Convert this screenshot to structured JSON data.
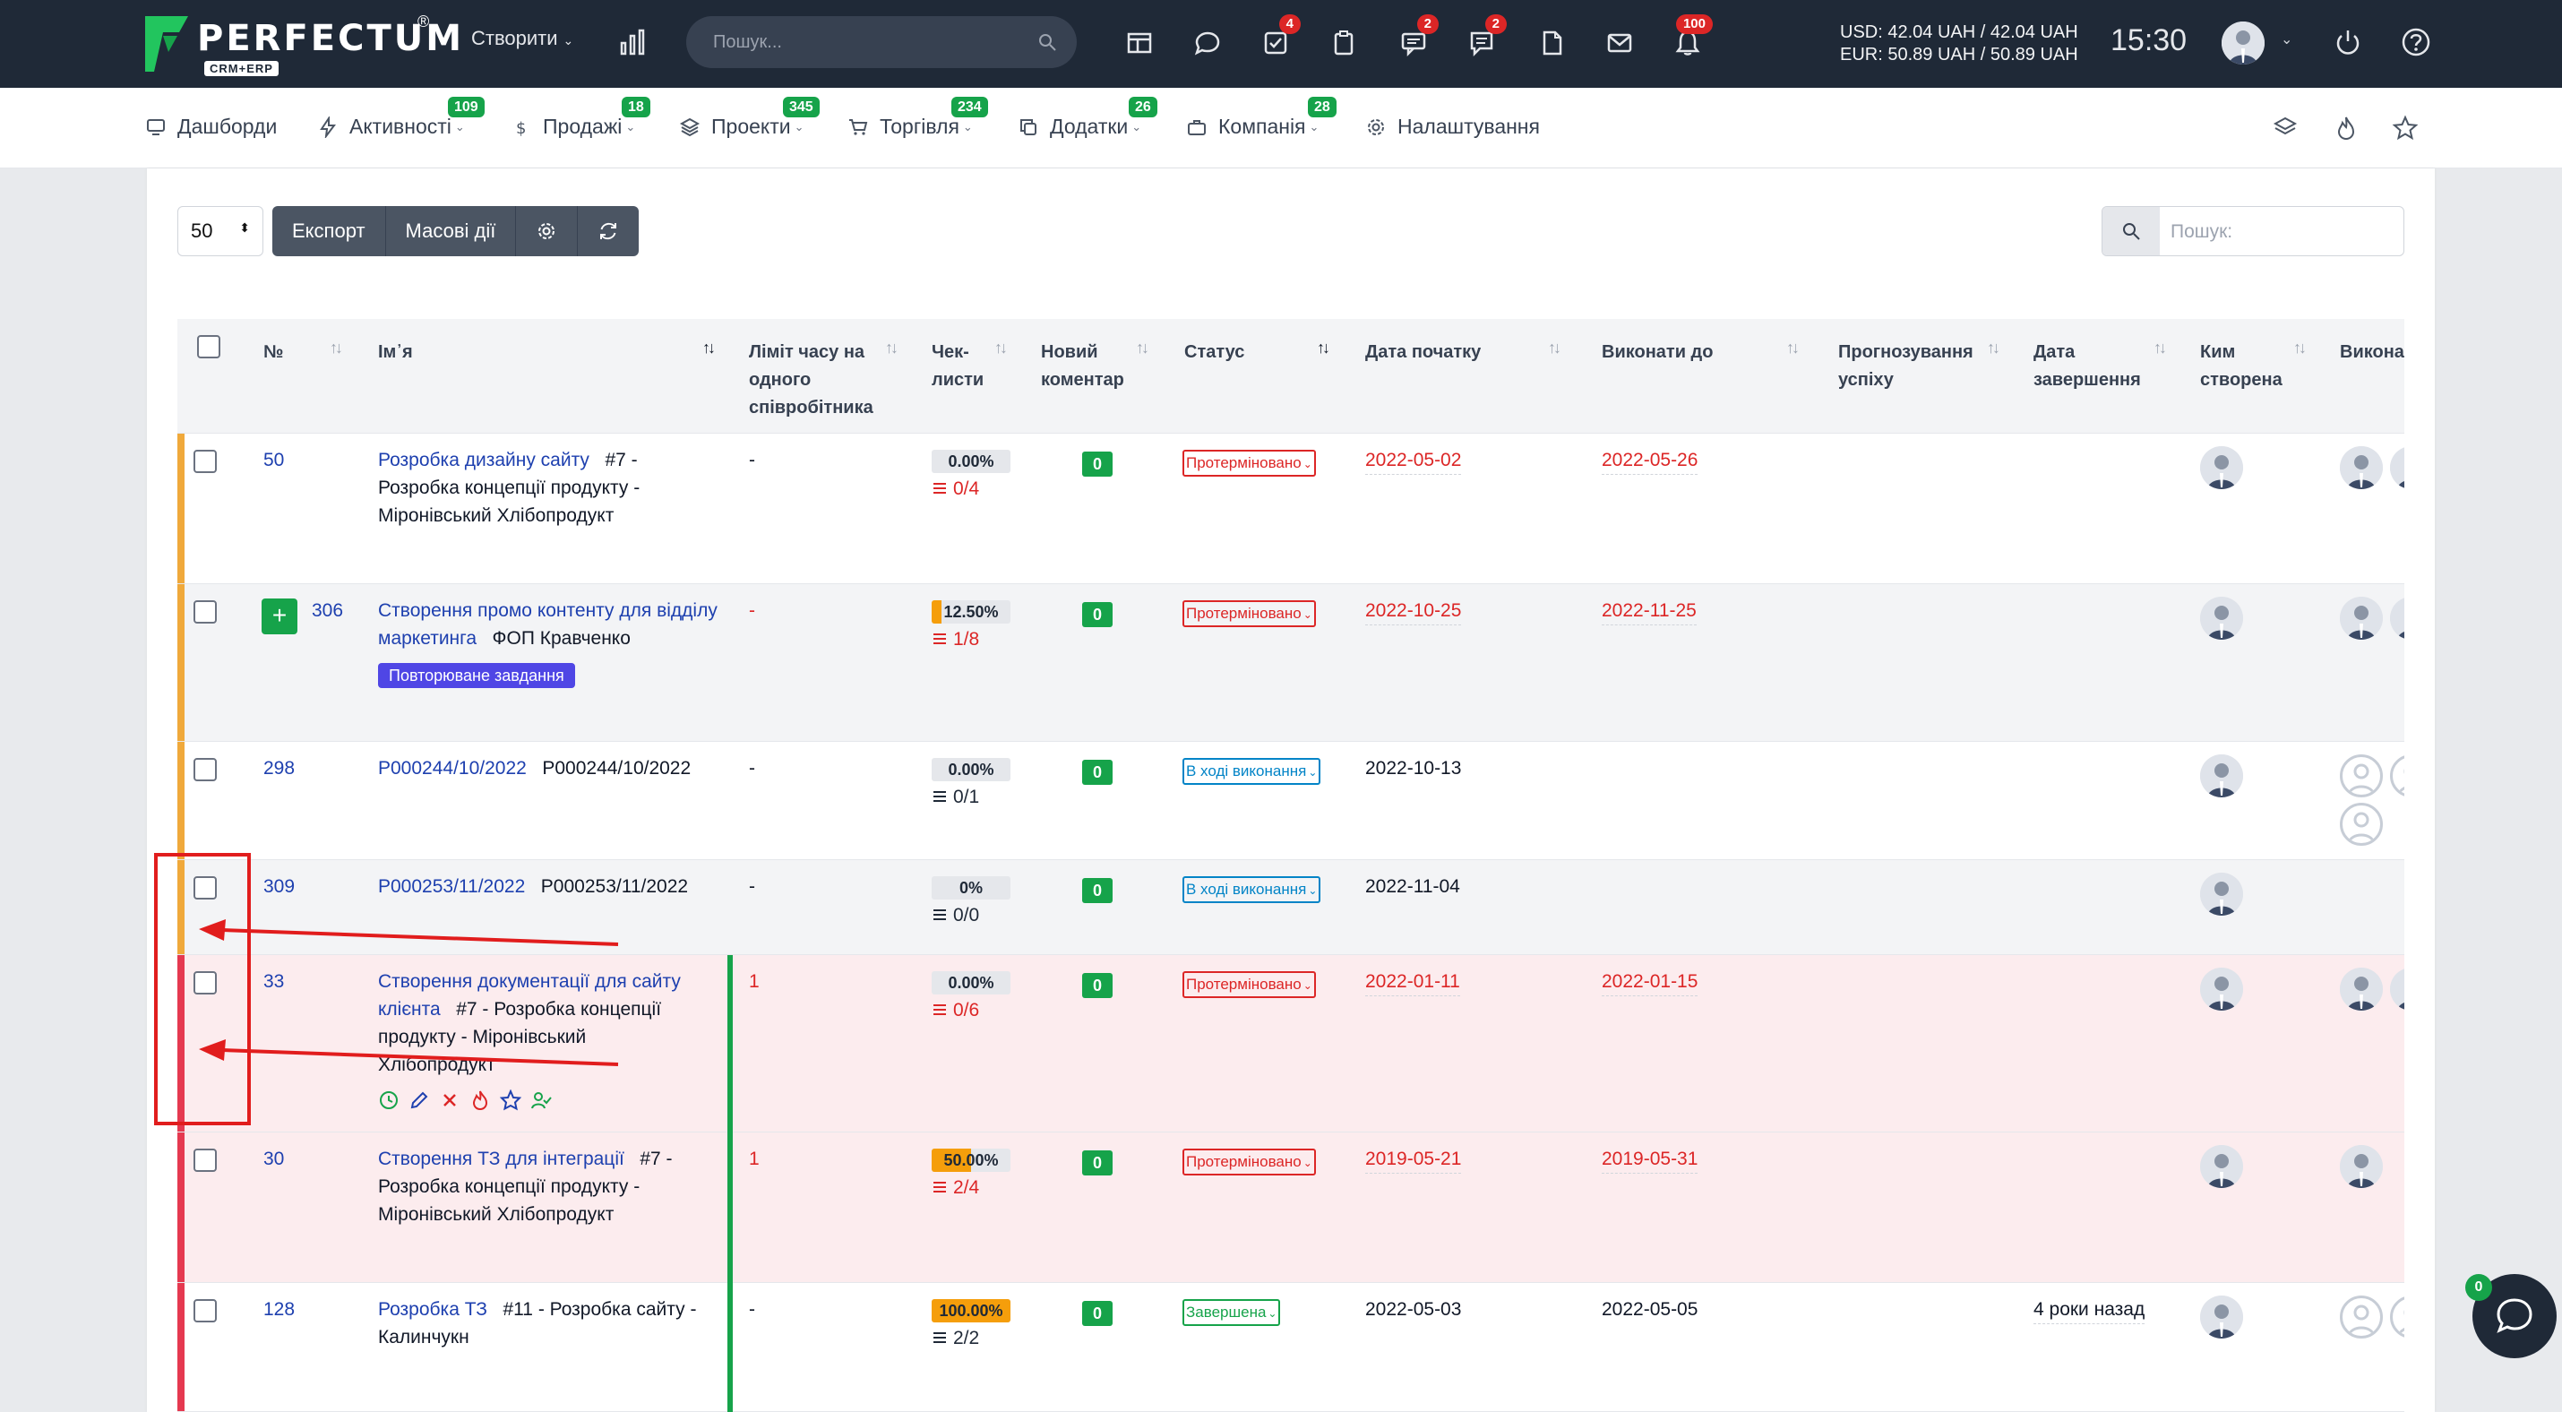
{
  "topbar": {
    "logo_text": "PERFECTUM",
    "logo_sub": "CRM+ERP",
    "logo_reg": "®",
    "create_label": "Створити",
    "search_placeholder": "Пошук...",
    "badges": {
      "tasks": "4",
      "chat": "2",
      "messages": "2",
      "notifications": "100"
    },
    "currency_usd": "USD: 42.04 UAH / 42.04 UAH",
    "currency_eur": "EUR: 50.89 UAH / 50.89 UAH",
    "time": "15:30"
  },
  "nav": {
    "items": [
      {
        "label": "Дашборди",
        "icon": "monitor-icon",
        "badge": ""
      },
      {
        "label": "Активності",
        "icon": "bolt-icon",
        "badge": "109"
      },
      {
        "label": "Продажі",
        "icon": "dollar-icon",
        "badge": "18"
      },
      {
        "label": "Проекти",
        "icon": "layers-icon",
        "badge": "345"
      },
      {
        "label": "Торгівля",
        "icon": "cart-icon",
        "badge": "234"
      },
      {
        "label": "Додатки",
        "icon": "copy-icon",
        "badge": "26"
      },
      {
        "label": "Компанія",
        "icon": "briefcase-icon",
        "badge": "28"
      },
      {
        "label": "Налаштування",
        "icon": "gear-icon",
        "badge": ""
      }
    ]
  },
  "toolbar": {
    "page_size": "50",
    "export_label": "Експорт",
    "bulk_label": "Масові дії",
    "search_placeholder": "Пошук:"
  },
  "table": {
    "columns": {
      "num": "№",
      "name": "Ім᾽я",
      "time_limit": "Ліміт часу на одного співробітника",
      "checklists": "Чек-листи",
      "new_comment": "Новий коментар",
      "status": "Статус",
      "start_date": "Дата початку",
      "due_date": "Виконати до",
      "forecast": "Прогнозування успіху",
      "end_date": "Дата завершення",
      "created_by": "Ким створена",
      "assignees": "Викона"
    },
    "rows": [
      {
        "num": "50",
        "name_link": "Розробка дизайну сайту",
        "name_rest": "#7 - Розробка концепції продукту - Міронівський Хлібопродукт",
        "limit": "-",
        "pct": "0.00%",
        "pct_value": 0,
        "checklist": "0/4",
        "comments": "0",
        "status": "Протерміновано",
        "start": "2022-05-02",
        "due": "2022-05-26",
        "end": ""
      },
      {
        "num": "306",
        "name_link": "Створення промо контенту для відділу маркетинга",
        "name_rest": "ФОП Кравченко",
        "tag": "Повторюване завдання",
        "limit": "-",
        "pct": "12.50%",
        "pct_value": 12.5,
        "checklist": "1/8",
        "comments": "0",
        "status": "Протерміновано",
        "start": "2022-10-25",
        "due": "2022-11-25",
        "end": ""
      },
      {
        "num": "298",
        "name_link": "P000244/10/2022",
        "name_rest": "P000244/10/2022",
        "limit": "-",
        "pct": "0.00%",
        "pct_value": 0,
        "checklist": "0/1",
        "comments": "0",
        "status": "В ході виконання",
        "start": "2022-10-13",
        "due": "",
        "end": ""
      },
      {
        "num": "309",
        "name_link": "P000253/11/2022",
        "name_rest": "P000253/11/2022",
        "limit": "-",
        "pct": "0%",
        "pct_value": 0,
        "checklist": "0/0",
        "comments": "0",
        "status": "В ході виконання",
        "start": "2022-11-04",
        "due": "",
        "end": ""
      },
      {
        "num": "33",
        "name_link": "Створення документації для сайту клієнта",
        "name_rest": "#7 - Розробка концепції продукту - Міронівський Хлібопродукт",
        "limit": "1",
        "pct": "0.00%",
        "pct_value": 0,
        "checklist": "0/6",
        "comments": "0",
        "status": "Протерміновано",
        "start": "2022-01-11",
        "due": "2022-01-15",
        "end": ""
      },
      {
        "num": "30",
        "name_link": "Створення ТЗ для інтеграції",
        "name_rest": "#7 - Розробка концепції продукту - Міронівський Хлібопродукт",
        "limit": "1",
        "pct": "50.00%",
        "pct_value": 50,
        "checklist": "2/4",
        "comments": "0",
        "status": "Протерміновано",
        "start": "2019-05-21",
        "due": "2019-05-31",
        "end": ""
      },
      {
        "num": "128",
        "name_link": "Розробка ТЗ",
        "name_rest": "#11 - Розробка сайту - Калинчукн",
        "limit": "-",
        "pct": "100.00%",
        "pct_value": 100,
        "checklist": "2/2",
        "comments": "0",
        "status": "Завершена",
        "start": "2022-05-03",
        "due": "2022-05-05",
        "end": "4 роки назад"
      }
    ]
  },
  "chat": {
    "badge": "0"
  },
  "colors": {
    "topbar": "#1f2937",
    "accent_green": "#16a34a",
    "overdue_red": "#dc2626",
    "annotation_red": "#e11d1d",
    "stripe_orange": "#f0a93b",
    "stripe_red": "#e53950"
  }
}
